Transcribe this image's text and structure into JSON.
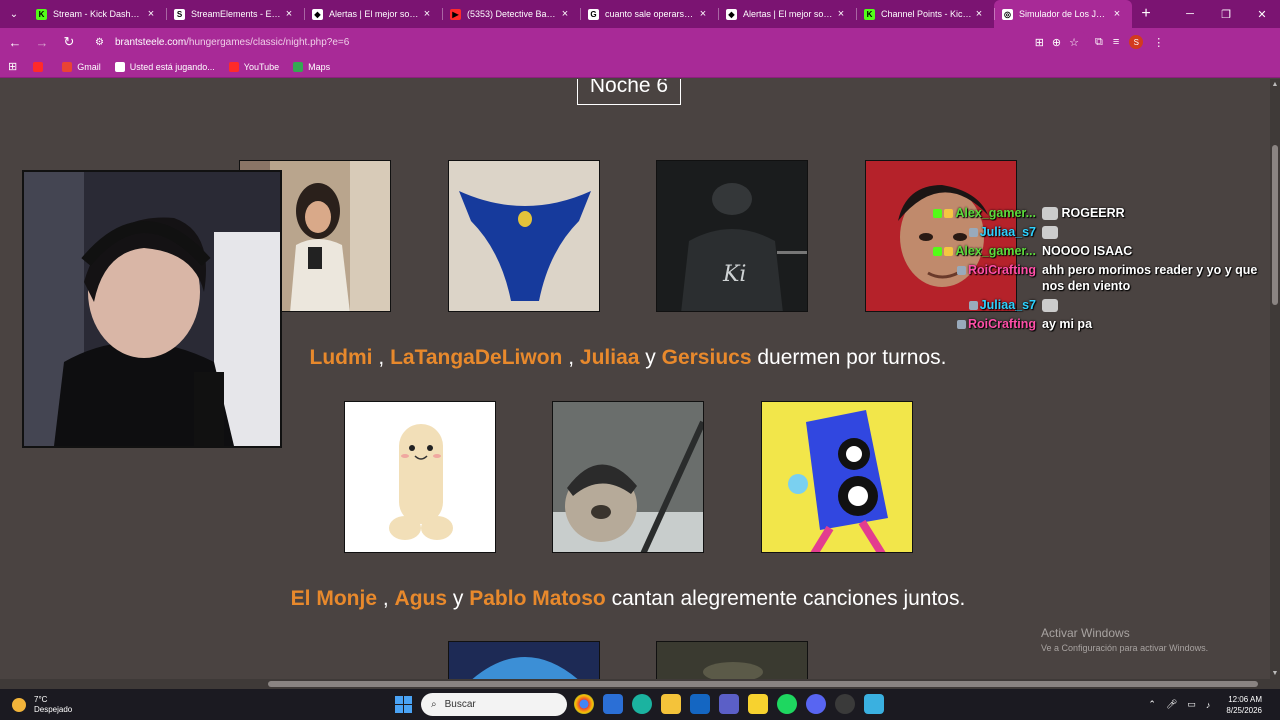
{
  "browser": {
    "tabs": [
      {
        "title": "Stream - Kick Dashboard",
        "fav_color": "#53fc18",
        "fav_letter": "K"
      },
      {
        "title": "StreamElements - Elemen",
        "fav_color": "#ffffff",
        "fav_letter": "S"
      },
      {
        "title": "Alertas | El mejor software",
        "fav_color": "#ffffff",
        "fav_letter": "◆"
      },
      {
        "title": "(5353) Detective Backgrou",
        "fav_color": "#ff2a2a",
        "fav_letter": "▶"
      },
      {
        "title": "cuanto sale operarse de la",
        "fav_color": "#ffffff",
        "fav_letter": "G"
      },
      {
        "title": "Alertas | El mejor software",
        "fav_color": "#ffffff",
        "fav_letter": "◆"
      },
      {
        "title": "Channel Points - Kick Da",
        "fav_color": "#53fc18",
        "fav_letter": "K"
      },
      {
        "title": "Simulador de Los Juegos",
        "fav_color": "#ffffff",
        "fav_letter": "◎"
      }
    ],
    "url_host": "brantsteele.com",
    "url_path": "/hungergames/classic/night.php?e=6",
    "bookmarks": [
      {
        "label": "",
        "color": "#ff2a2a"
      },
      {
        "label": "Gmail",
        "color": "#ea4335"
      },
      {
        "label": "Usted está jugando...",
        "color": "#ffffff"
      },
      {
        "label": "YouTube",
        "color": "#ff2a2a"
      },
      {
        "label": "Maps",
        "color": "#34a853"
      }
    ]
  },
  "page": {
    "title": "Noche 6",
    "events": [
      {
        "names": [
          "Ludmi",
          "LaTangaDeLiwon",
          "Juliaa",
          "Gersiucs"
        ],
        "sep1": ",",
        "sep2": ",",
        "sep3": "y",
        "action": "duermen por turnos."
      },
      {
        "names": [
          "El Monje",
          "Agus",
          "Pablo Matoso"
        ],
        "sep1": ",",
        "sep2": "y",
        "action": "cantan alegremente canciones juntos."
      }
    ]
  },
  "chat": [
    {
      "user": "Alex_gamer...",
      "color": "#5ddc3c",
      "message": "ROGEERR"
    },
    {
      "user": "Juliaa_s7",
      "color": "#2ed2ff",
      "message": ""
    },
    {
      "user": "Alex_gamer...",
      "color": "#5ddc3c",
      "message": "NOOOO ISAAC"
    },
    {
      "user": "RoiCrafting",
      "color": "#ff4fa8",
      "message": "ahh pero morimos reader y yo y que nos den viento"
    },
    {
      "user": "Juliaa_s7",
      "color": "#2ed2ff",
      "message": ""
    },
    {
      "user": "RoiCrafting",
      "color": "#ff4fa8",
      "message": "ay mi pa"
    }
  ],
  "watermark": {
    "line1": "Activar Windows",
    "line2": "Ve a Configuración para activar Windows."
  },
  "taskbar": {
    "temp": "7°C",
    "weather": "Despejado",
    "search_placeholder": "Buscar",
    "time": "12:06 AM",
    "date": "8/25/2026"
  }
}
